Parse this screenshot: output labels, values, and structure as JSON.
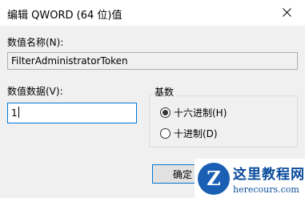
{
  "window": {
    "title": "编辑 QWORD (64 位)值",
    "close_glyph": "✕"
  },
  "value_name": {
    "label": "数值名称(N):",
    "value": "FilterAdministratorToken"
  },
  "value_data": {
    "label": "数值数据(V):",
    "value": "1"
  },
  "base": {
    "label": "基数",
    "options": [
      {
        "label": "十六进制(H)",
        "selected": true
      },
      {
        "label": "十进制(D)",
        "selected": false
      }
    ]
  },
  "buttons": {
    "ok_label": "确定"
  },
  "watermark": {
    "logo_letter": "Z",
    "site_name": "这里教程网",
    "site_url": "herecours.com"
  },
  "colors": {
    "accent": "#0078d7",
    "dialog_bg": "#f0f0f0",
    "watermark_blue": "#1a5fb4"
  }
}
